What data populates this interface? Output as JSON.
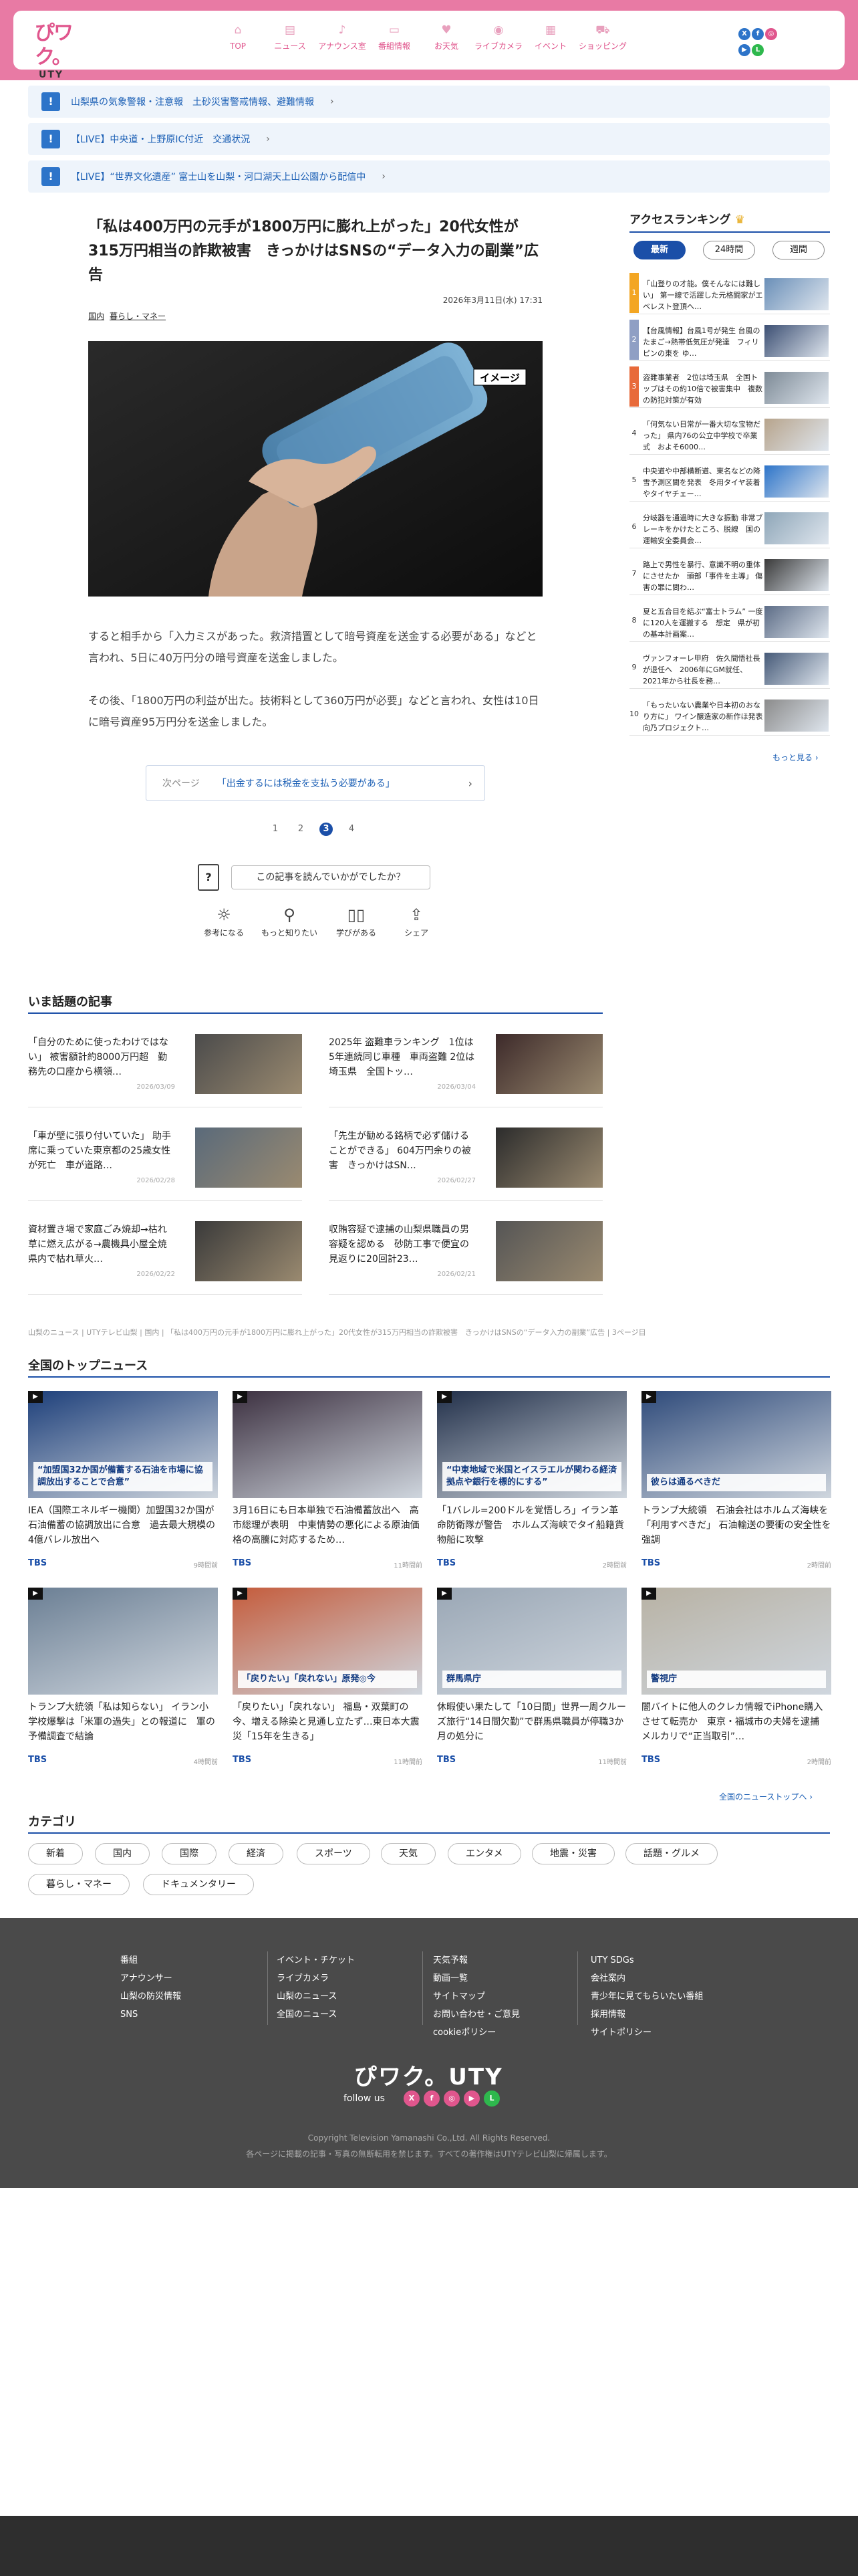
{
  "header": {
    "logo_text": "UTY",
    "nav": [
      {
        "icon": "home-icon",
        "glyph": "⌂",
        "label": "TOP"
      },
      {
        "icon": "news-icon",
        "glyph": "▤",
        "label": "ニュース"
      },
      {
        "icon": "microphone-icon",
        "glyph": "♪",
        "label": "アナウンス室"
      },
      {
        "icon": "tv-icon",
        "glyph": "▭",
        "label": "番組情報"
      },
      {
        "icon": "gift-icon",
        "glyph": "♥",
        "label": "お天気"
      },
      {
        "icon": "camera-icon",
        "glyph": "◉",
        "label": "ライブカメラ"
      },
      {
        "icon": "calendar-icon",
        "glyph": "▦",
        "label": "イベント"
      },
      {
        "icon": "cart-icon",
        "glyph": "⛟",
        "label": "ショッピング"
      }
    ],
    "social": [
      "X",
      "f",
      "◎",
      "▶",
      "L"
    ]
  },
  "alerts": [
    "山梨県の気象警報・注意報　土砂災害警戒情報、避難情報",
    "【LIVE】中央道・上野原IC付近　交通状況",
    "【LIVE】“世界文化遺産” 富士山を山梨・河口湖天上山公園から配信中"
  ],
  "article": {
    "title": "「私は400万円の元手が1800万円に膨れ上がった」20代女性が315万円相当の詐欺被害　きっかけはSNSの“データ入力の副業”広告",
    "date": "2026年3月11日(水) 17:31",
    "tags": [
      "国内",
      "暮らし・マネー"
    ],
    "image_label": "イメージ",
    "paragraphs": [
      "すると相手から「入力ミスがあった。救済措置として暗号資産を送金する必要がある」などと言われ、5日に40万円分の暗号資産を送金しました。",
      "その後、「1800万円の利益が出た。技術料として360万円が必要」などと言われ、女性は10日に暗号資産95万円分を送金しました。"
    ],
    "next_label": "次ページ",
    "next_title": "「出金するには税金を支払う必要がある」",
    "pages": [
      "1",
      "2",
      "3",
      "4"
    ],
    "current_page": "3",
    "question": "この記事を読んでいかがでしたか？",
    "reactions": [
      "参考になる",
      "もっと知りたい",
      "学びがある",
      "シェア"
    ]
  },
  "ranking": {
    "title": "アクセスランキング",
    "tabs": [
      "最新",
      "24時間",
      "週間"
    ],
    "active_tab": "最新",
    "items": [
      {
        "n": "1",
        "text": "「山登りの才能。僕そんなには難しい」 第一線で活躍した元格闘家がエベレスト登頂へ…"
      },
      {
        "n": "2",
        "text": "【台風情報】台風1号が発生 台風のたまご→熱帯低気圧が発達　フィリピンの東を ゆ…"
      },
      {
        "n": "3",
        "text": "盗難事業者　2位は埼玉県　全国トップはその約10倍で被害集中　複数の防犯対策が有効"
      },
      {
        "n": "4",
        "text": "「何気ない日常が一番大切な宝物だった」 県内76の公立中学校で卒業式　およそ6000…"
      },
      {
        "n": "5",
        "text": "中央道や中部横断道、東名などの降雪予測区間を発表　冬用タイヤ装着やタイヤチェー…"
      },
      {
        "n": "6",
        "text": "分岐器を通過時に大きな振動 非常ブレーキをかけたところ、脱線　国の運輸安全委員会…"
      },
      {
        "n": "7",
        "text": "路上で男性を暴行、意識不明の重体にさせたか　頭部「事件を主導」 傷害の罪に問わ…"
      },
      {
        "n": "8",
        "text": "夏と五合目を結ぶ“富士トラム” 一度に120人を運搬する　想定　県が初の基本計画案…"
      },
      {
        "n": "9",
        "text": "ヴァンフォーレ甲府　佐久間悟社長が退任へ　2006年にGM就任、2021年から社長を務…"
      },
      {
        "n": "10",
        "text": "「もったいない農業や日本初のおなり方に」 ワイン醸造家の新作ほ発表向乃プロジェクト…"
      }
    ],
    "more": "もっと見る ›"
  },
  "trending": {
    "title": "いま話題の記事",
    "items": [
      {
        "title": "「自分のために使ったわけではない」 被害額計約8000万円超　勤務先の口座から横領…",
        "date": "2026/03/09"
      },
      {
        "title": "2025年 盗難車ランキング　1位は5年連続同じ車種　車両盗難 2位は埼玉県　全国トッ…",
        "date": "2026/03/04"
      },
      {
        "title": "「車が壁に張り付いていた」 助手席に乗っていた東京都の25歳女性が死亡　車が道路…",
        "date": "2026/02/28"
      },
      {
        "title": "「先生が勧める銘柄で必ず儲けることができる」 604万円余りの被害　きっかけはSN…",
        "date": "2026/02/27"
      },
      {
        "title": "資材置き場で家庭ごみ焼却→枯れ草に燃え広がる→農機具小屋全焼　県内で枯れ草火…",
        "date": "2026/02/22"
      },
      {
        "title": "収賄容疑で逮捕の山梨県職員の男容疑を認める　砂防工事で便宜の見返りに20回計23…",
        "date": "2026/02/21"
      }
    ]
  },
  "breadcrumb": "山梨のニュース | UTYテレビ山梨 | 国内 | 「私は400万円の元手が1800万円に膨れ上がった」20代女性が315万円相当の詐欺被害　きっかけはSNSの“データ入力の副業”広告 | 3ページ目",
  "topnews": {
    "title": "全国のトップニュース",
    "items": [
      {
        "title": "IEA（国際エネルギー機関）加盟国32か国が石油備蓄の協調放出に合意　過去最大規模の4億バレル放出へ",
        "src": "TBS",
        "time": "9時間前",
        "overlay": "“加盟国32か国が備蓄する石油を市場に協調放出することで合意”"
      },
      {
        "title": "3月16日にも日本単独で石油備蓄放出へ　高市総理が表明　中東情勢の悪化による原油価格の高騰に対応するため…",
        "src": "TBS",
        "time": "11時間前",
        "overlay": ""
      },
      {
        "title": "「1バレル=200ドルを覚悟しろ」イラン革命防衛隊が警告　ホルムズ海峡でタイ船籍貨物船に攻撃",
        "src": "TBS",
        "time": "2時間前",
        "overlay": "“中東地域で米国とイスラエルが関わる経済拠点や銀行を標的にする”"
      },
      {
        "title": "トランプ大統領　石油会社はホルムズ海峡を「利用すべきだ」 石油輸送の要衝の安全性を強調",
        "src": "TBS",
        "time": "2時間前",
        "overlay": "彼らは通るべきだ"
      },
      {
        "title": "トランプ大統領「私は知らない」 イラン小学校爆撃は「米軍の過失」との報道に　軍の予備調査で結論",
        "src": "TBS",
        "time": "4時間前",
        "overlay": ""
      },
      {
        "title": "「戻りたい」「戻れない」 福島・双葉町の今、増える除染と見通し立たず…東日本大震災「15年を生きる」",
        "src": "TBS",
        "time": "11時間前",
        "overlay": "「戻りたい」「戻れない」原発◎今"
      },
      {
        "title": "休暇使い果たして「10日間」世界一周クルーズ旅行“14日間欠勤”で群馬県職員が停職3か月の処分に",
        "src": "TBS",
        "time": "11時間前",
        "overlay": "群馬県庁"
      },
      {
        "title": "闇バイトに他人のクレカ情報でiPhone購入させて転売か　東京・福城市の夫婦を逮捕　メルカリで“正当取引”…",
        "src": "TBS",
        "time": "2時間前",
        "overlay": "警視庁"
      }
    ],
    "more": "全国のニューストップへ ›"
  },
  "categories": {
    "title": "カテゴリ",
    "items": [
      "新着",
      "国内",
      "国際",
      "経済",
      "スポーツ",
      "天気",
      "エンタメ",
      "地震・災害",
      "話題・グルメ",
      "暮らし・マネー",
      "ドキュメンタリー"
    ]
  },
  "footer": {
    "cols": [
      [
        "番組",
        "アナウンサー",
        "山梨の防災情報",
        "SNS"
      ],
      [
        "イベント・チケット",
        "ライブカメラ",
        "山梨のニュース",
        "全国のニュース"
      ],
      [
        "天気予報",
        "動画一覧",
        "サイトマップ",
        "お問い合わせ・ご意見",
        "cookieポリシー"
      ],
      [
        "UTY SDGs",
        "会社案内",
        "青少年に見てもらいたい番組",
        "採用情報",
        "サイトポリシー"
      ]
    ],
    "logo": "UTY",
    "follow": "follow us",
    "copyright": "Copyright Television Yamanashi Co.,Ltd. All Rights Reserved.",
    "notice": "各ページに掲載の記事・写真の無断転用を禁じます。すべての著作権はUTYテレビ山梨に帰属します。"
  },
  "colors": {
    "brand_pink": "#e87aa4",
    "accent_blue": "#1b4fa8"
  }
}
